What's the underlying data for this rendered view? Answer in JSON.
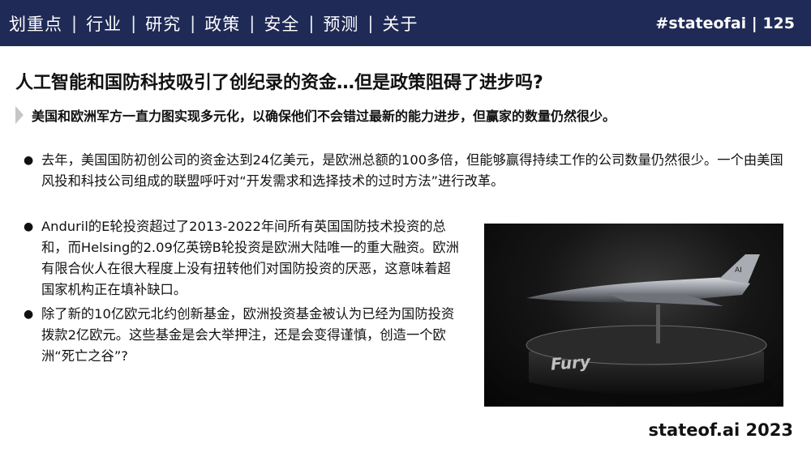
{
  "nav": {
    "items": [
      {
        "label": "划重点"
      },
      {
        "label": "行业"
      },
      {
        "label": "研究"
      },
      {
        "label": "政策"
      },
      {
        "label": "安全"
      },
      {
        "label": "预测"
      },
      {
        "label": "关于"
      }
    ],
    "separator": "|",
    "active_index": 3
  },
  "header": {
    "tag": "#stateofai | 125"
  },
  "slide": {
    "title": "人工智能和国防科技吸引了创纪录的资金…但是政策阻碍了进步吗?",
    "subtitle": "美国和欧洲军方一直力图实现多元化，以确保他们不会错过最新的能力进步，但赢家的数量仍然很少。",
    "bullets": [
      "去年，美国国防初创公司的资金达到24亿美元，是欧洲总额的100多倍，但能够赢得持续工作的公司数量仍然很少。一个由美国风投和科技公司组成的联盟呼吁对“开发需求和选择技术的过时方法”进行改革。",
      "Anduril的E轮投资超过了2013-2022年间所有英国国防技术投资的总和，而Helsing的2.09亿英镑B轮投资是欧洲大陆唯一的重大融资。欧洲有限合伙人在很大程度上没有扭转他们对国防投资的厌恶，这意味着超国家机构正在填补缺口。",
      "除了新的10亿欧元北约创新基金，欧洲投资基金被认为已经为国防投资拨款2亿欧元。这些基金是会大举押注，还是会变得谨慎，创造一个欧洲“死亡之谷”?"
    ],
    "bullet_char": "●"
  },
  "image": {
    "caption": "Fury",
    "tail_mark": "AI"
  },
  "footer": {
    "text": "stateof.ai 2023"
  },
  "colors": {
    "header_bg": "#1f2a56",
    "text": "#111111",
    "chevron": "#c6c6c6"
  }
}
